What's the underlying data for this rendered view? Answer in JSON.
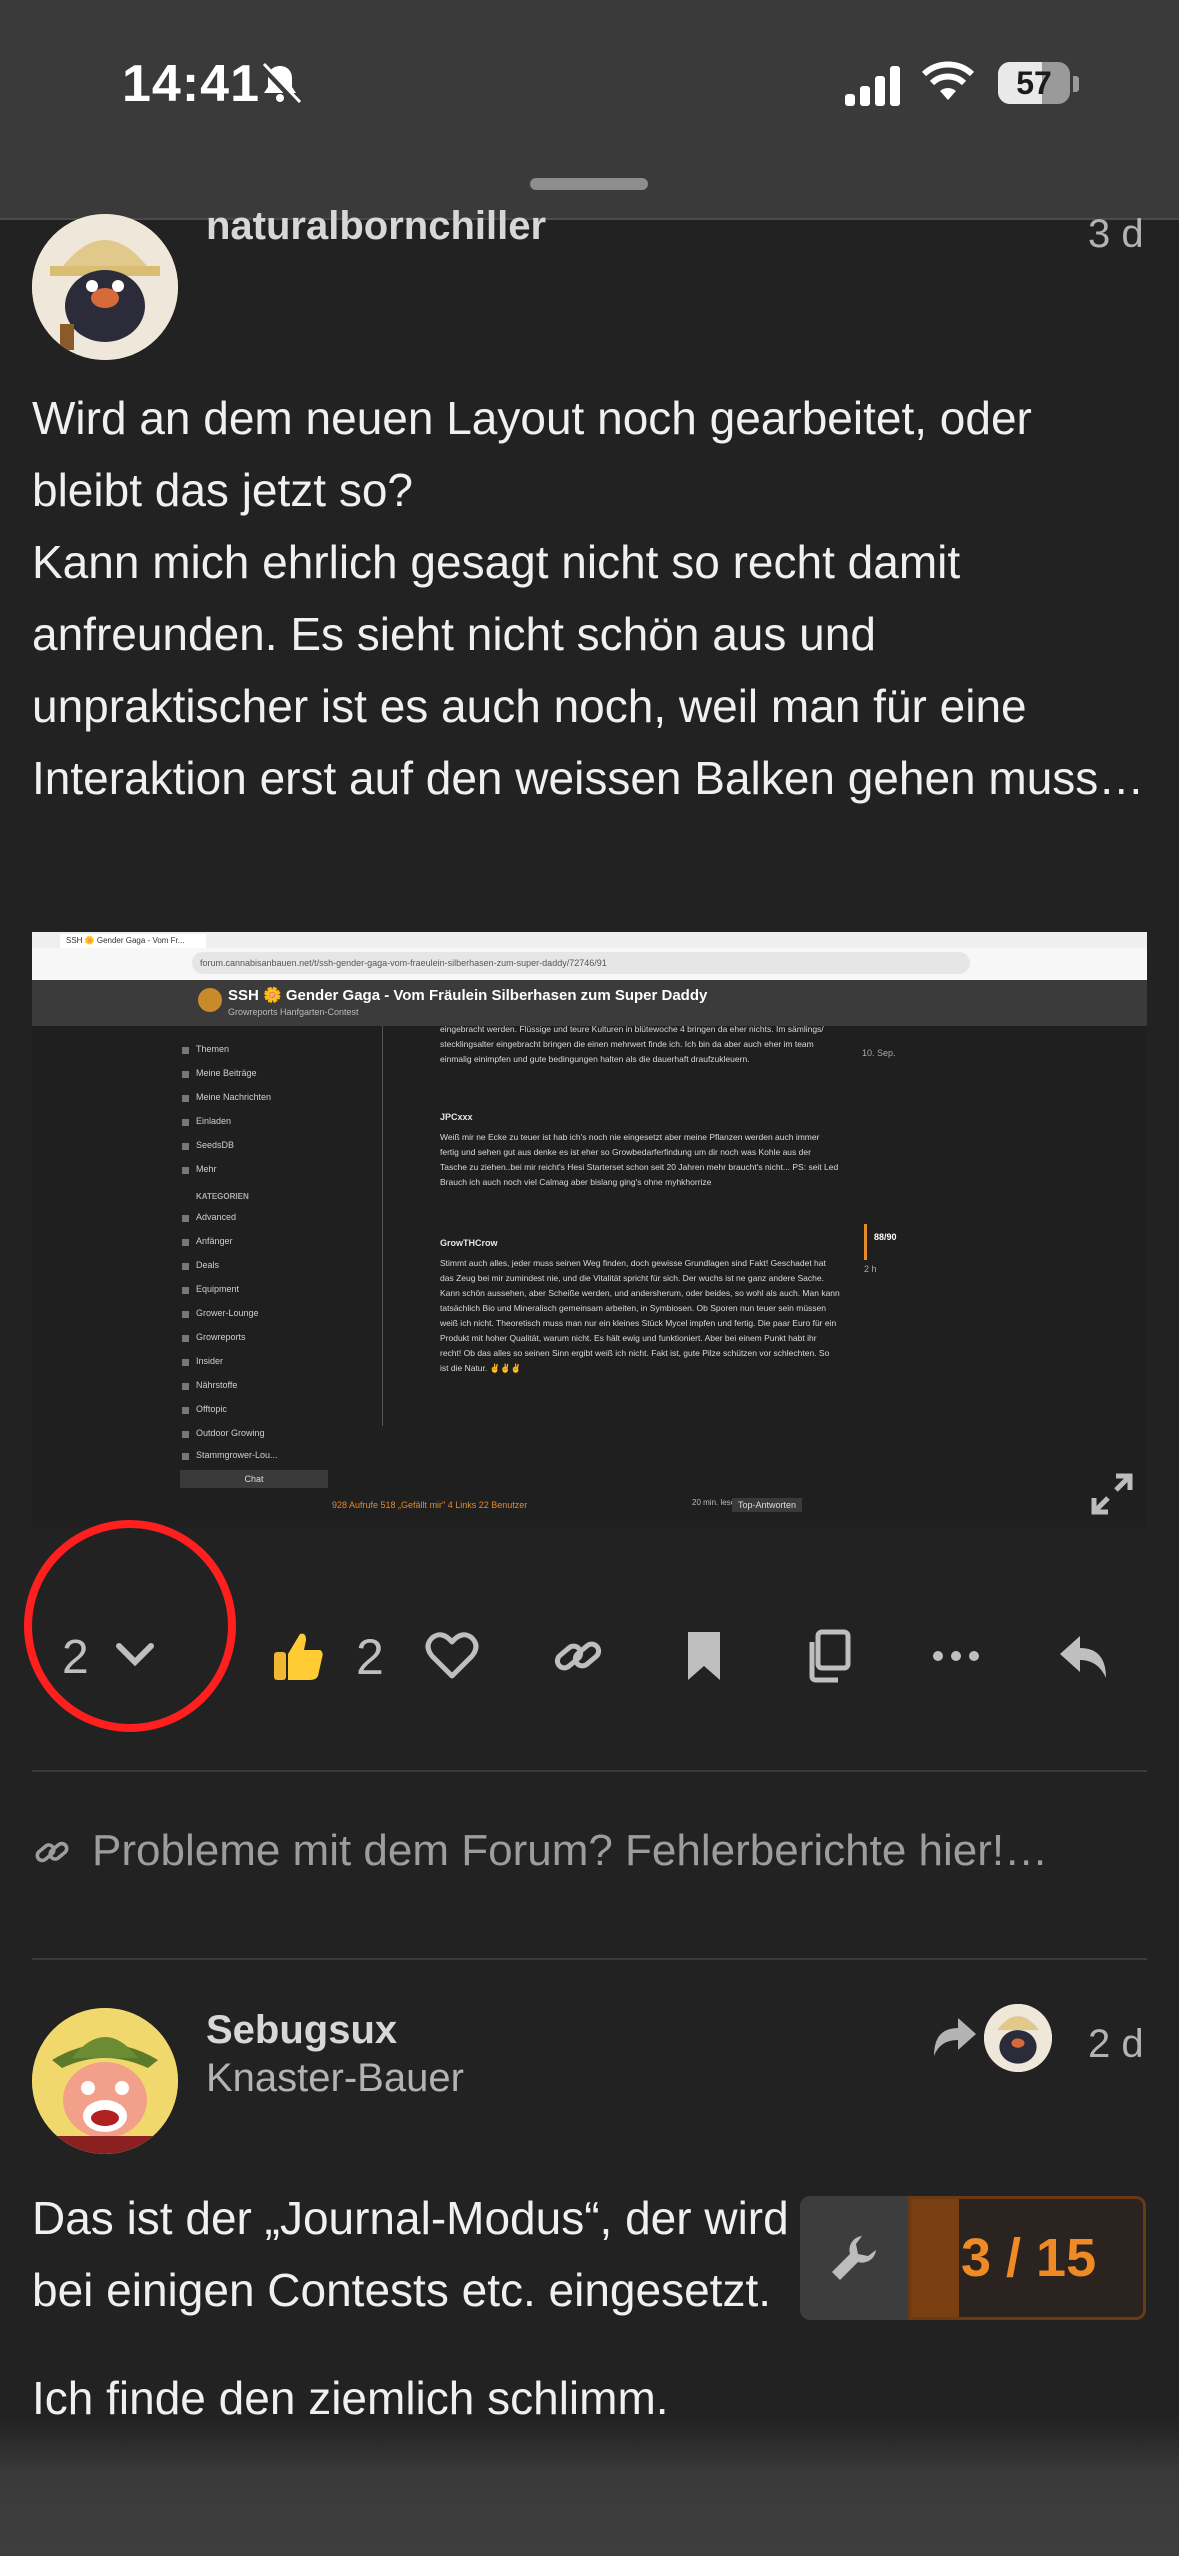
{
  "status_bar": {
    "time": "14:41",
    "battery": "57"
  },
  "post1": {
    "username": "naturalbornchiller",
    "date": "3 d",
    "paragraphs": [
      "Wird an dem neuen Layout noch gearbeitet, oder bleibt das jetzt so?",
      "Kann mich ehrlich gesagt nicht so recht damit anfreunden. Es sieht nicht schön aus und unpraktischer ist es auch noch, weil man für eine Interaktion erst auf den weissen Balken gehen muss…"
    ],
    "screenshot": {
      "tab_title": "SSH 🌼 Gender Gaga - Vom Fr...",
      "url": "forum.cannabisanbauen.net/t/ssh-gender-gaga-vom-fraeulein-silberhasen-zum-super-daddy/72746/91",
      "topic_title": "SSH 🌼 Gender Gaga - Vom Fräulein Silberhasen zum Super Daddy",
      "topic_tags": "Growreports  Hanfgarten-Contest",
      "sidebar": [
        "Themen",
        "Meine Beiträge",
        "Meine Nachrichten",
        "Einladen",
        "SeedsDB",
        "Mehr"
      ],
      "categories_label": "KATEGORIEN",
      "categories": [
        "Advanced",
        "Anfänger",
        "Deals",
        "Equipment",
        "Grower-Lounge",
        "Growreports",
        "Insider",
        "Nährstoffe",
        "Offtopic",
        "Outdoor Growing",
        "Stammgrower-Lou..."
      ],
      "chat_label": "Chat",
      "messages": [
        {
          "name": "",
          "text": "eingebracht werden. Flüssige und teure Kulturen in blütewoche 4 bringen da eher nichts. Im sämlings/ stecklingsalter eingebracht bringen die einen mehrwert finde ich. Ich bin da aber auch eher im team einmalig einimpfen und gute bedingungen halten als die dauerhaft draufzukleuern."
        },
        {
          "name": "JPCxxx",
          "text": "Weiß mir ne Ecke zu teuer ist hab ich's noch nie eingesetzt aber meine Pflanzen werden auch immer fertig und sehen gut aus denke es ist eher so Growbedarferfindung um dir noch was Kohle aus der Tasche zu ziehen..bei mir reicht's Hesi Starterset schon seit 20 Jahren mehr braucht's nicht... PS: seit Led Brauch ich auch noch viel Calmag aber bislang ging's ohne myhkhorrize"
        },
        {
          "name": "GrowTHCrow",
          "text": "Stimmt auch alles, jeder muss seinen Weg finden, doch gewisse Grundlagen sind Fakt! Geschadet hat das Zeug bei mir zumindest nie, und die Vitalität spricht für sich. Der wuchs ist ne ganz andere Sache. Kann schön aussehen, aber Scheiße werden, und andersherum, oder beides, so wohl als auch. Man kann tatsächlich Bio und Mineralisch gemeinsam arbeiten, in Symbiosen. Ob Sporen nun teuer sein müssen weiß ich nicht. Theoretisch muss man nur ein kleines Stück Mycel impfen und fertig. Die paar Euro für ein Produkt mit hoher Qualität, warum nicht. Es hält ewig und funktioniert. Aber bei einem Punkt habt ihr recht! Ob das alles so seinen Sinn ergibt weiß ich nicht. Fakt ist, gute Pilze schützen vor schlechten. So ist die Natur. ✌✌✌"
        }
      ],
      "timeline_date": "10. Sep.",
      "timeline_pos": "88/90",
      "timeline_ago": "2 h",
      "stats": "928 Aufrufe   518 „Gefällt mir\"   4 Links   22 Benutzer",
      "read_time": "20 min. lesen",
      "top_answers": "Top-Antworten"
    },
    "actions": {
      "replies_count": "2",
      "likes_count": "2"
    }
  },
  "topic_link": {
    "text": "Probleme mit dem Forum? Fehlerberichte hier!…"
  },
  "post2": {
    "username": "Sebugsux",
    "user_title": "Knaster-Bauer",
    "date": "2 d",
    "paragraphs": [
      "Das ist der „Journal-Modus“, der wird bei einigen Contests etc. eingesetzt.",
      "Ich finde den ziemlich schlimm."
    ]
  },
  "progress": {
    "label": "3 / 15",
    "fraction": 0.2
  }
}
